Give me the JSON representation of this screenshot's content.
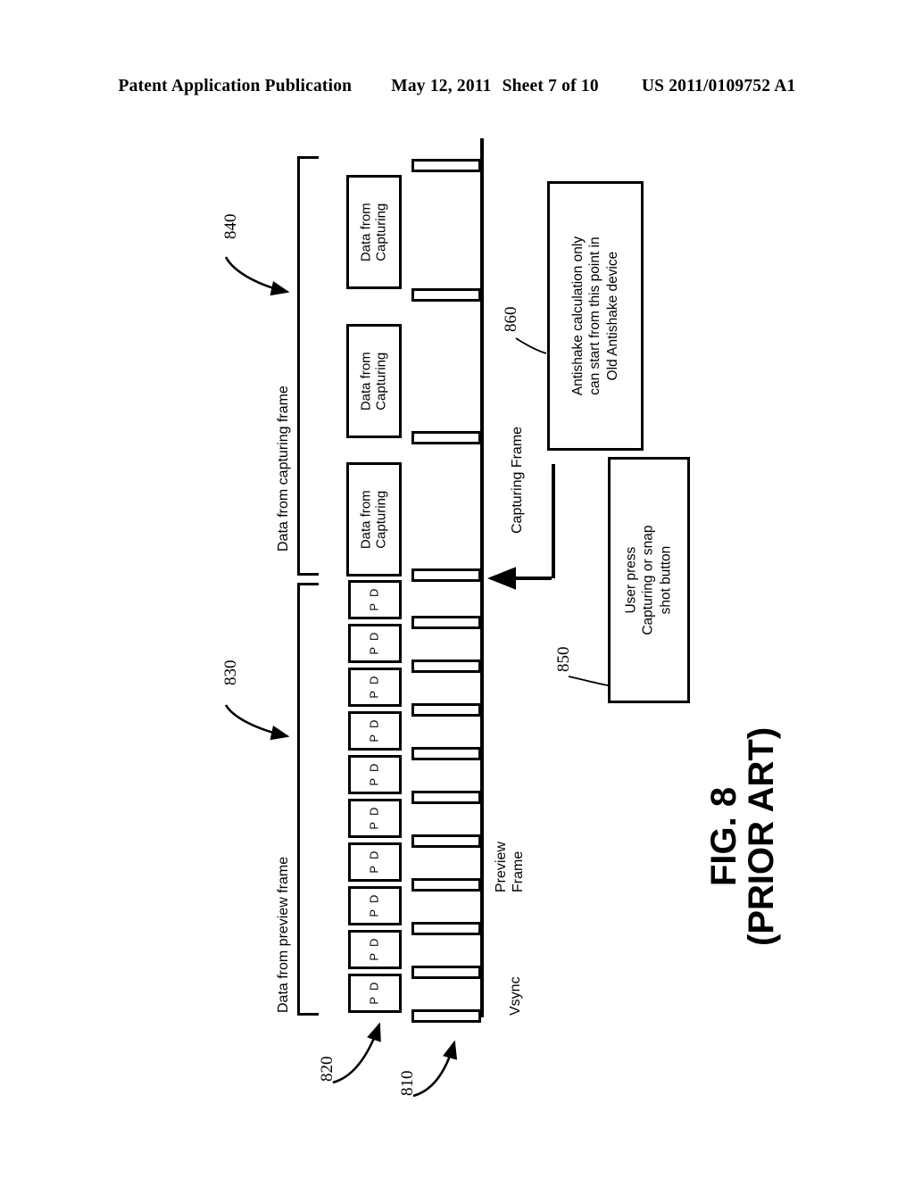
{
  "header": {
    "publication": "Patent Application Publication",
    "date": "May 12, 2011",
    "sheet": "Sheet 7 of 10",
    "docnumber": "US 2011/0109752 A1"
  },
  "figure": {
    "caption_line1": "FIG. 8",
    "caption_line2": "(PRIOR ART)",
    "axis_label": "Vsync",
    "preview_frame_label_line1": "Preview",
    "preview_frame_label_line2": "Frame",
    "capturing_frame_label": "Capturing Frame",
    "group_capturing_label": "Data from capturing frame",
    "group_preview_label": "Data from preview frame",
    "data_box_line1": "Data from",
    "data_box_line2": "Capturing",
    "pd_box_line1": "P",
    "pd_box_line2": "D",
    "note_antishake": {
      "line1": "Antishake calculation only",
      "line2": "can start from this point in",
      "line3": "Old Antishake device"
    },
    "note_userpress": {
      "line1": "User press",
      "line2": "Capturing or snap",
      "line3": "shot button"
    },
    "refnums": {
      "r810": "810",
      "r820": "820",
      "r830": "830",
      "r840": "840",
      "r850": "850",
      "r860": "860"
    }
  },
  "chart_data": {
    "type": "line",
    "title": "FIG. 8 (PRIOR ART) - Vsync timing of preview and capturing frames",
    "xlabel": "Vsync",
    "ylabel": "",
    "grid": false,
    "legend_position": "none",
    "series": [
      {
        "name": "Preview Frame Vsync pulses",
        "count": 10,
        "values": [
          1,
          1,
          1,
          1,
          1,
          1,
          1,
          1,
          1,
          1
        ]
      },
      {
        "name": "Capturing Frame Vsync pulses",
        "count": 4,
        "values": [
          1,
          1,
          1,
          1
        ]
      }
    ],
    "annotations": [
      "810 - Vsync pulse",
      "820 - Preview data block (P D)",
      "830 - Data from preview frame group",
      "840 - Data from capturing frame group",
      "850 - User press Capturing or snap shot button",
      "860 - Antishake calculation only can start from this point in Old Antishake device"
    ]
  }
}
